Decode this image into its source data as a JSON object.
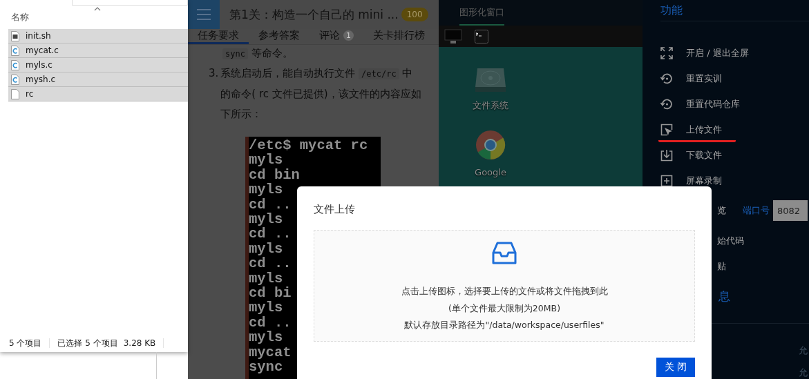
{
  "explorer": {
    "column_header": "名称",
    "files": [
      {
        "name": "init.sh",
        "kind": "script",
        "selected": true
      },
      {
        "name": "mycat.c",
        "kind": "c",
        "selected": true
      },
      {
        "name": "myls.c",
        "kind": "c",
        "selected": true
      },
      {
        "name": "mysh.c",
        "kind": "c",
        "selected": true
      },
      {
        "name": "rc",
        "kind": "plain",
        "selected": true
      }
    ],
    "status": {
      "count": "5 个项目",
      "selection": "已选择 5 个项目",
      "size": "3.28 KB"
    }
  },
  "task_panel": {
    "title": "第1关：构造一个自己的 mini ...",
    "score": "100",
    "tabs": [
      {
        "label": "任务要求",
        "selected": true
      },
      {
        "label": "参考答案",
        "selected": false
      },
      {
        "label": "评论",
        "selected": false,
        "badge": "1"
      },
      {
        "label": "关卡排行榜",
        "selected": false
      }
    ],
    "partial_line": [
      {
        "text": "sync",
        "kind": "code"
      },
      {
        "text": " 等命令。",
        "kind": "text"
      }
    ],
    "list_item": {
      "number": "3.",
      "parts": [
        {
          "text": "系统启动后，能自动执行文件 ",
          "kind": "text"
        },
        {
          "text": "/etc/rc",
          "kind": "code"
        },
        {
          "text": " 中的命令( rc 文件已提供)，该文件的内容应如下所示：",
          "kind": "text"
        }
      ]
    },
    "terminal_lines": [
      "/etc$ mycat rc",
      "myls",
      "cd bin",
      "myls",
      "cd ..",
      "myls",
      "cd ..",
      "myls",
      "cd ..",
      "myls",
      "cd bi",
      "myls",
      "cd ..",
      "myls",
      "mycat",
      "sync"
    ]
  },
  "graphic_window": {
    "tab": "图形化窗口",
    "desktop_icons": [
      {
        "kind": "drive",
        "label": "文件系统"
      },
      {
        "kind": "browser",
        "label": "Google"
      }
    ]
  },
  "function_panel": {
    "title": "功能",
    "items": [
      {
        "kind": "fullscreen",
        "label": "开启 / 退出全屏",
        "highlighted": false
      },
      {
        "kind": "reset",
        "label": "重置实训",
        "highlighted": false
      },
      {
        "kind": "reset",
        "label": "重置代码仓库",
        "highlighted": false
      },
      {
        "kind": "upload",
        "label": "上传文件",
        "highlighted": true
      },
      {
        "kind": "download",
        "label": "下载文件",
        "highlighted": false
      },
      {
        "kind": "record",
        "label": "屏幕录制",
        "highlighted": false
      },
      {
        "kind": "preview",
        "label": "览",
        "highlighted": false
      },
      {
        "kind": "plain",
        "label": "始代码",
        "highlighted": false
      },
      {
        "kind": "plain",
        "label": "贴",
        "highlighted": false
      },
      {
        "kind": "section",
        "label": "息",
        "highlighted": false
      }
    ],
    "port": {
      "label": "端口号",
      "value": "8082"
    },
    "notes": [
      "允",
      "允"
    ]
  },
  "dialog": {
    "title": "文件上传",
    "lines": [
      "点击上传图标，选择要上传的文件或将文件拖拽到此",
      "(单个文件最大限制为20MB)",
      "默认存放目录路径为\"/data/workspace/userfiles\""
    ],
    "close_button": "关 闭"
  }
}
